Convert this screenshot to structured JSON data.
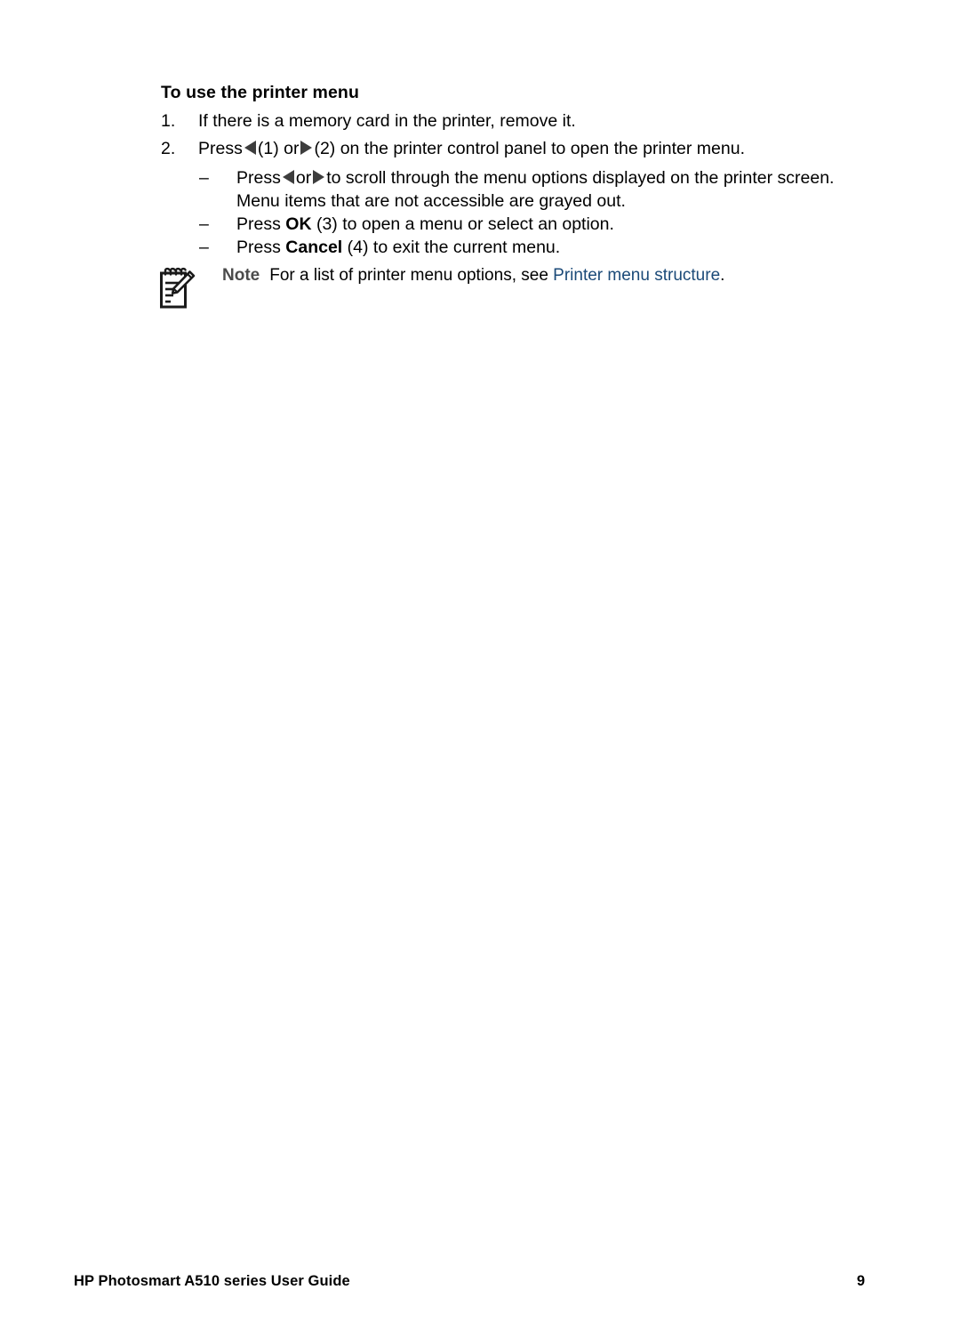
{
  "document": {
    "heading": "To use the printer menu"
  },
  "steps": [
    {
      "number": "1.",
      "segments_text": "If there is a memory card in the printer, remove it."
    },
    {
      "number": "2.",
      "prefix": "Press",
      "after_left_triangle": "(1) or",
      "after_right_triangle": "(2) on the printer control panel to open the printer menu."
    }
  ],
  "substeps": [
    {
      "marker": "–",
      "prefix": "Press",
      "between_triangles": "or",
      "after_triangles": "to scroll through the menu options displayed on the printer screen.",
      "second_line": "Menu items that are not accessible are grayed out."
    },
    {
      "marker": "–",
      "prefix": "Press",
      "bold_term": "OK",
      "suffix": "(3) to open a menu or select an option."
    },
    {
      "marker": "–",
      "prefix": "Press",
      "bold_term": "Cancel",
      "suffix": "(4) to exit the current menu."
    }
  ],
  "note": {
    "icon": "note-pencil-icon",
    "label": "Note",
    "text": "For a list of printer menu options, see",
    "link_text": "Printer menu structure",
    "trailing": ".",
    "link_color": "#1b4a78",
    "label_color": "#4b4b4b"
  },
  "footer": {
    "title": "HP Photosmart A510 series User Guide",
    "page_number": "9"
  },
  "icons": {
    "triangle_left": "triangle-left-icon",
    "triangle_right": "triangle-right-icon"
  }
}
